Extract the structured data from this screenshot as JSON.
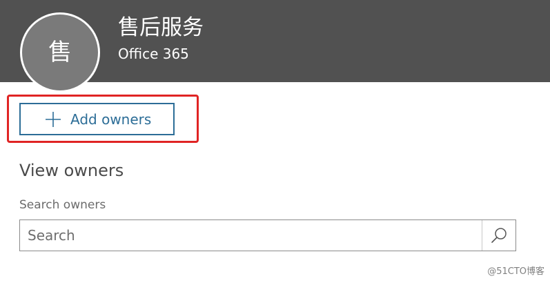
{
  "header": {
    "avatar_initial": "售",
    "group_name": "售后服务",
    "group_type": "Office 365"
  },
  "actions": {
    "add_owners_label": "Add owners"
  },
  "owners_section": {
    "heading": "View owners",
    "search_label": "Search owners",
    "search_placeholder": "Search",
    "search_value": ""
  },
  "watermark": {
    "text": "@51CTO博客"
  },
  "colors": {
    "header_background": "#515151",
    "avatar_background": "#7a7a7a",
    "accent_blue": "#2c6d97",
    "highlight_red": "#e02424"
  },
  "icons": {
    "add": "plus-icon",
    "search": "search-icon"
  }
}
